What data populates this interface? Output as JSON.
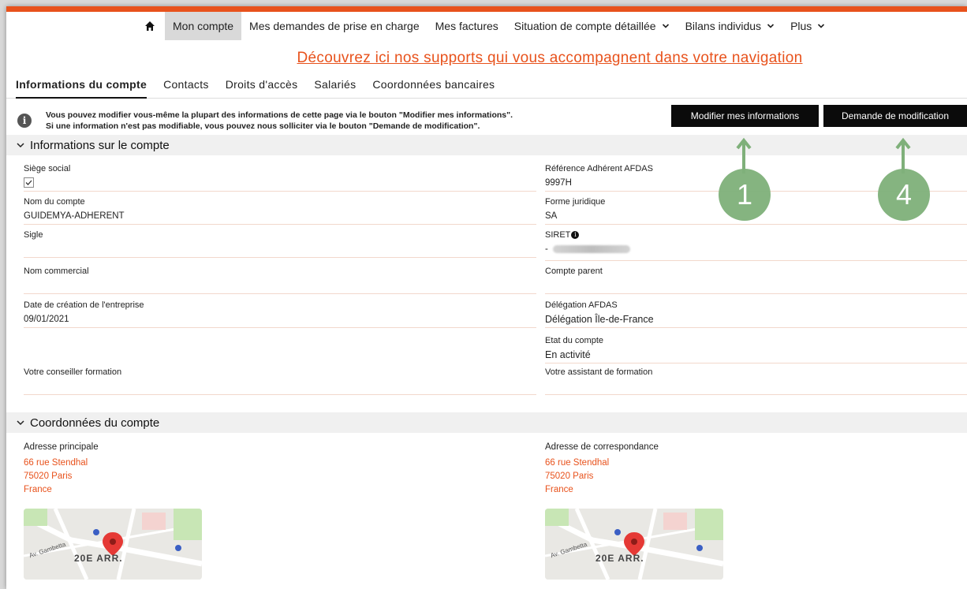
{
  "nav": {
    "items": [
      {
        "label": "Mon compte",
        "active": true
      },
      {
        "label": "Mes demandes de prise en charge"
      },
      {
        "label": "Mes factures"
      },
      {
        "label": "Situation de compte détaillée",
        "dropdown": true
      },
      {
        "label": "Bilans individus",
        "dropdown": true
      },
      {
        "label": "Plus",
        "dropdown": true
      }
    ]
  },
  "banner": {
    "link_text": "Découvrez ici nos supports qui vous accompagnent dans votre navigation"
  },
  "tabs": [
    {
      "label": "Informations du compte",
      "active": true
    },
    {
      "label": "Contacts"
    },
    {
      "label": "Droits d'accès"
    },
    {
      "label": "Salariés"
    },
    {
      "label": "Coordonnées bancaires"
    }
  ],
  "info": {
    "line1": "Vous pouvez modifier vous-même la plupart des informations de cette page via le bouton \"Modifier mes informations\".",
    "line2": "Si une information n'est pas modifiable, vous pouvez nous solliciter via le bouton \"Demande de modification\"."
  },
  "buttons": {
    "edit": "Modifier mes informations",
    "request": "Demande de modification"
  },
  "callouts": {
    "edit": "1",
    "request": "4"
  },
  "account_section": {
    "title": "Informations sur le compte",
    "left": [
      {
        "label": "Siège social",
        "checkbox": true,
        "checked": true
      },
      {
        "label": "Nom du compte",
        "value": "GUIDEMYA-ADHERENT"
      },
      {
        "label": "Sigle",
        "value": ""
      },
      {
        "label": "Nom commercial",
        "value": ""
      },
      {
        "label": "Date de création de l'entreprise",
        "value": "09/01/2021"
      },
      {
        "label": "Votre conseiller formation",
        "value": ""
      }
    ],
    "right": [
      {
        "label": "Référence Adhérent AFDAS",
        "value": "9997H"
      },
      {
        "label": "Forme juridique",
        "value": "SA"
      },
      {
        "label": "SIRET",
        "value": "-"
      },
      {
        "label": "Compte parent",
        "value": ""
      },
      {
        "label": "Délégation AFDAS",
        "value": "Délégation Île-de-France"
      },
      {
        "label": "Etat du compte",
        "value": "En activité"
      },
      {
        "label": "Votre assistant de formation",
        "value": ""
      }
    ]
  },
  "coords_section": {
    "title": "Coordonnées du compte",
    "main": {
      "label": "Adresse principale",
      "line1": "66 rue Stendhal",
      "line2": "75020 Paris",
      "line3": "France"
    },
    "corr": {
      "label": "Adresse de correspondance",
      "line1": "66 rue Stendhal",
      "line2": "75020 Paris",
      "line3": "France"
    },
    "map": {
      "street": "Av. Gambetta",
      "district": "20E ARR."
    }
  },
  "colors": {
    "accent": "#e8521c",
    "callout": "#7fb07a",
    "button": "#0b0b0b"
  }
}
